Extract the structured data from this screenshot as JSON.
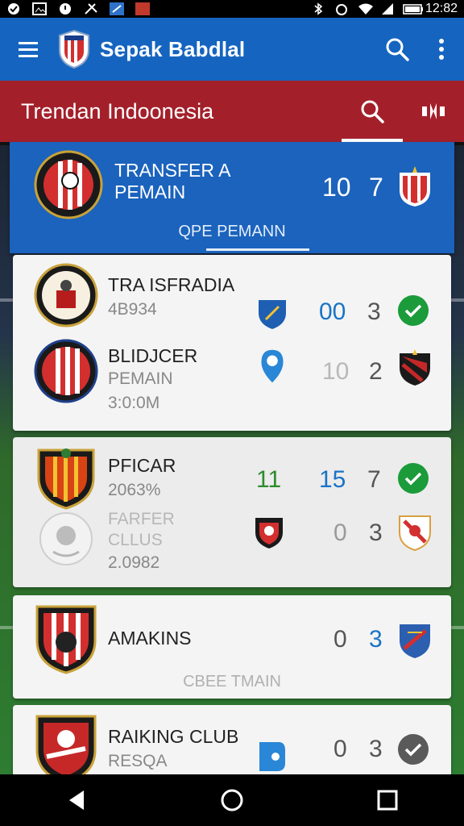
{
  "status_bar": {
    "time": "12:82"
  },
  "app_bar": {
    "title": "Sepak Babdlal"
  },
  "sub_bar": {
    "title": "Trendan Indoonesia"
  },
  "featured": {
    "name_line1": "TRANSFER A",
    "name_line2": "PEMAIN",
    "score_home": "10",
    "score_away": "7",
    "tab_label": "QPE PEMANN"
  },
  "cards": [
    {
      "rows": [
        {
          "name": "TRA ISFRADIA",
          "sub1": "4B934",
          "sub2": "",
          "score_home": "00",
          "score_away": "3",
          "status": "check"
        },
        {
          "name": "BLIDJCER",
          "sub1": "PEMAIN",
          "sub2": "3:0:0M",
          "score_home": "10",
          "score_away": "2",
          "status": "badge"
        }
      ]
    },
    {
      "rows": [
        {
          "name": "PFICAR",
          "sub1": "2063%",
          "sub2": "",
          "score_left": "11",
          "score_home": "15",
          "score_away": "7",
          "status": "check"
        },
        {
          "name": "FARFER",
          "sub1": "CLLUS",
          "sub2": "2.0982",
          "score_home": "0",
          "score_away": "3",
          "status": "badge"
        }
      ]
    },
    {
      "rows": [
        {
          "name": "AMAKINS",
          "score_home": "0",
          "score_away": "3",
          "status": "badge"
        }
      ],
      "footer": "CBEE TMAIN"
    },
    {
      "rows": [
        {
          "name": "RAIKING CLUB",
          "sub1": "RESQA",
          "score_home": "0",
          "score_away": "3",
          "status": "check-dark"
        }
      ]
    }
  ],
  "colors": {
    "primary": "#1565c0",
    "secondary": "#a3202b",
    "check": "#1b9b3a",
    "score_blue": "#1a73c7",
    "score_green": "#2e8b2e"
  },
  "icons": [
    "menu-icon",
    "club-logo",
    "search-icon",
    "more-vert-icon",
    "filter-icon",
    "check-icon",
    "back-icon",
    "home-icon",
    "recents-icon"
  ]
}
